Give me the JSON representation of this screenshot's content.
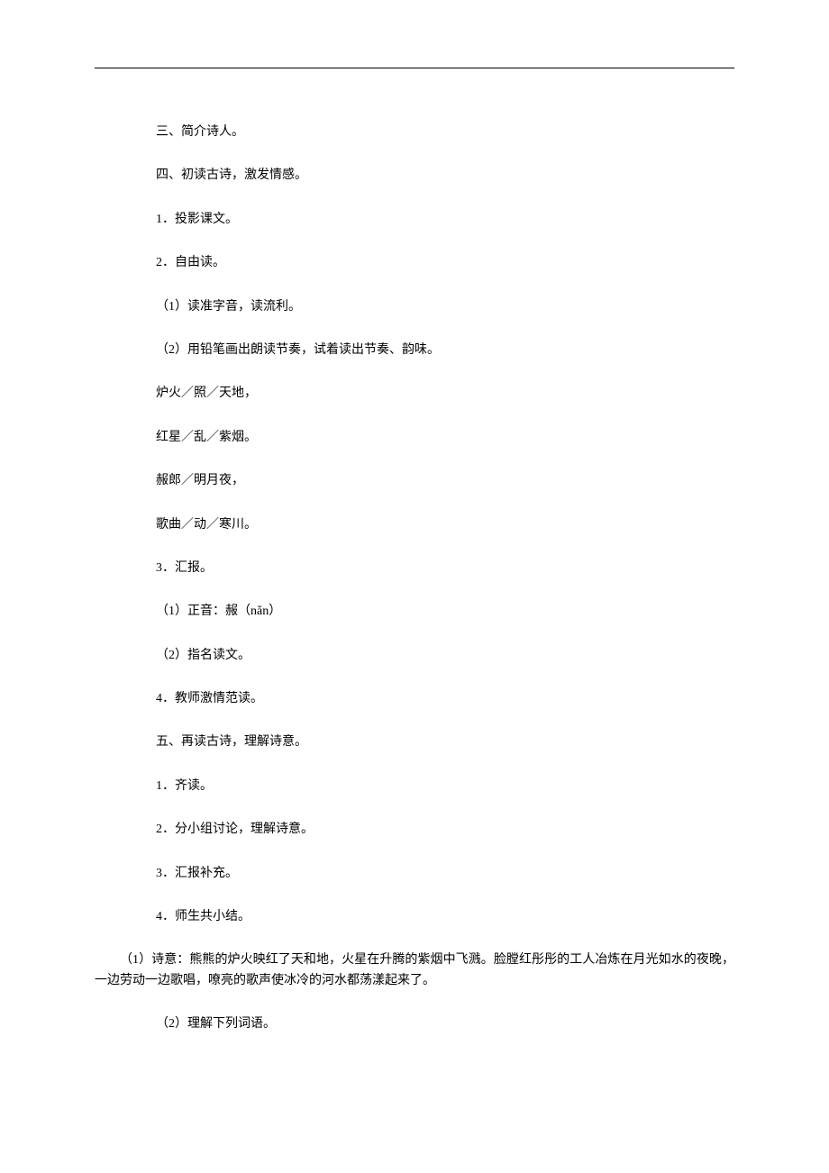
{
  "lines": {
    "l0": "三、简介诗人。",
    "l1": "四、初读古诗，激发情感。",
    "l2": "1．投影课文。",
    "l3": "2．自由读。",
    "l4": "（1）读准字音，读流利。",
    "l5": "（2）用铅笔画出朗读节奏，试着读出节奏、韵味。",
    "l6": "炉火／照／天地，",
    "l7": "红星／乱／紫烟。",
    "l8": "赧郎／明月夜，",
    "l9": "歌曲／动／寒川。",
    "l10": "3．汇报。",
    "l11": "（1）正音：赧（nǎn）",
    "l12": "（2）指名读文。",
    "l13": "4．教师激情范读。",
    "l14": "五、再读古诗，理解诗意。",
    "l15": "1．齐读。",
    "l16": "2．分小组讨论，理解诗意。",
    "l17": "3．汇报补充。",
    "l18": "4．师生共小结。",
    "l19": "（1）诗意：熊熊的炉火映红了天和地，火星在升腾的紫烟中飞溅。脸膛红彤彤的工人冶炼在月光如水的夜晚，一边劳动一边歌唱，嘹亮的歌声使冰冷的河水都荡漾起来了。",
    "l20": "（2）理解下列词语。"
  }
}
